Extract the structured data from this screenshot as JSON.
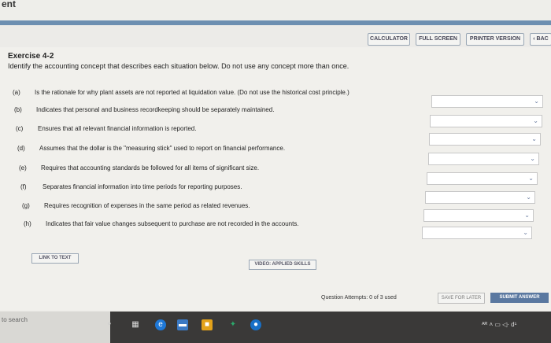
{
  "window": {
    "title_fragment": "ent"
  },
  "toolbar": {
    "calculator": "CALCULATOR",
    "full_screen": "FULL SCREEN",
    "printer_version": "PRINTER VERSION",
    "back": "‹ BAC"
  },
  "exercise": {
    "title": "Exercise 4-2",
    "instruction": "Identify the accounting concept that describes each situation below. Do not use any concept more than once.",
    "items": [
      {
        "letter": "(a)",
        "text": "Is the rationale for why plant assets are not reported at liquidation value. (Do not use the historical cost principle.)"
      },
      {
        "letter": "(b)",
        "text": "Indicates that personal and business recordkeeping should be separately maintained."
      },
      {
        "letter": "(c)",
        "text": "Ensures that all relevant financial information is reported."
      },
      {
        "letter": "(d)",
        "text": "Assumes that the dollar is the \"measuring stick\" used to report on financial performance."
      },
      {
        "letter": "(e)",
        "text": "Requires that accounting standards be followed for all items of significant size."
      },
      {
        "letter": "(f)",
        "text": "Separates financial information into time periods for reporting purposes."
      },
      {
        "letter": "(g)",
        "text": "Requires recognition of expenses in the same period as related revenues."
      },
      {
        "letter": "(h)",
        "text": "Indicates that fair value changes subsequent to purchase are not recorded in the accounts."
      }
    ]
  },
  "links": {
    "link_to_text": "LINK TO TEXT",
    "video": "VIDEO: APPLIED SKILLS"
  },
  "footer": {
    "attempts": "Question Attempts: 0 of 3 used",
    "save_later": "SAVE FOR LATER",
    "submit": "SUBMIT ANSWER"
  },
  "taskbar": {
    "search_text": "to search",
    "tray_text": "ᴬᴿ ˄ ▭ ◁· d¹"
  }
}
